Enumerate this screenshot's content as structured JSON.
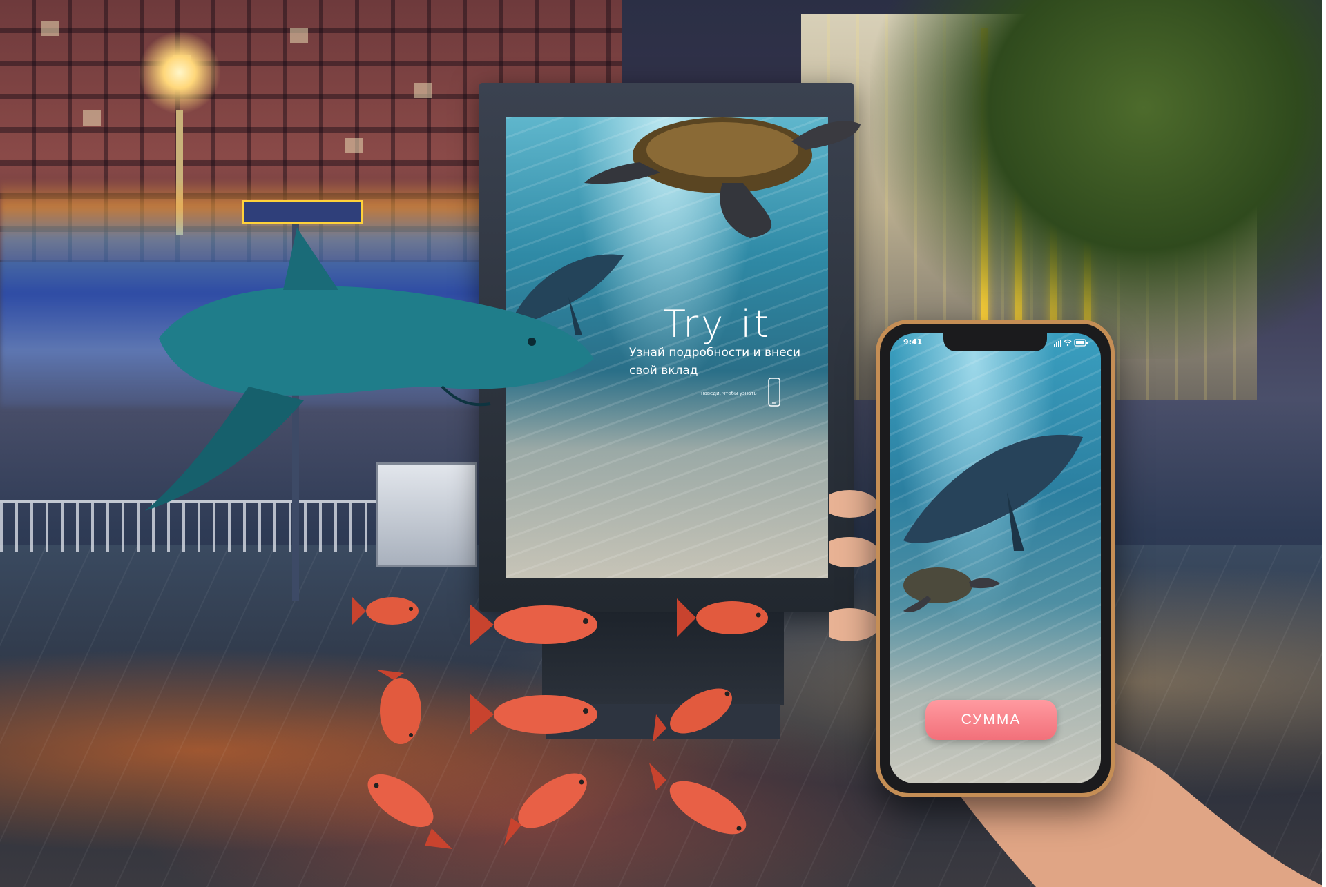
{
  "poster": {
    "title": "Try it",
    "subtitle": "Узнай подробности и внеси свой вклад",
    "hint": "наведи, чтобы узнать"
  },
  "phone": {
    "status_time": "9:41",
    "button_label": "СУММА",
    "button_color": "#f2707a"
  },
  "icons": [
    "phone-outline-icon",
    "signal-icon",
    "wifi-icon",
    "battery-icon"
  ]
}
